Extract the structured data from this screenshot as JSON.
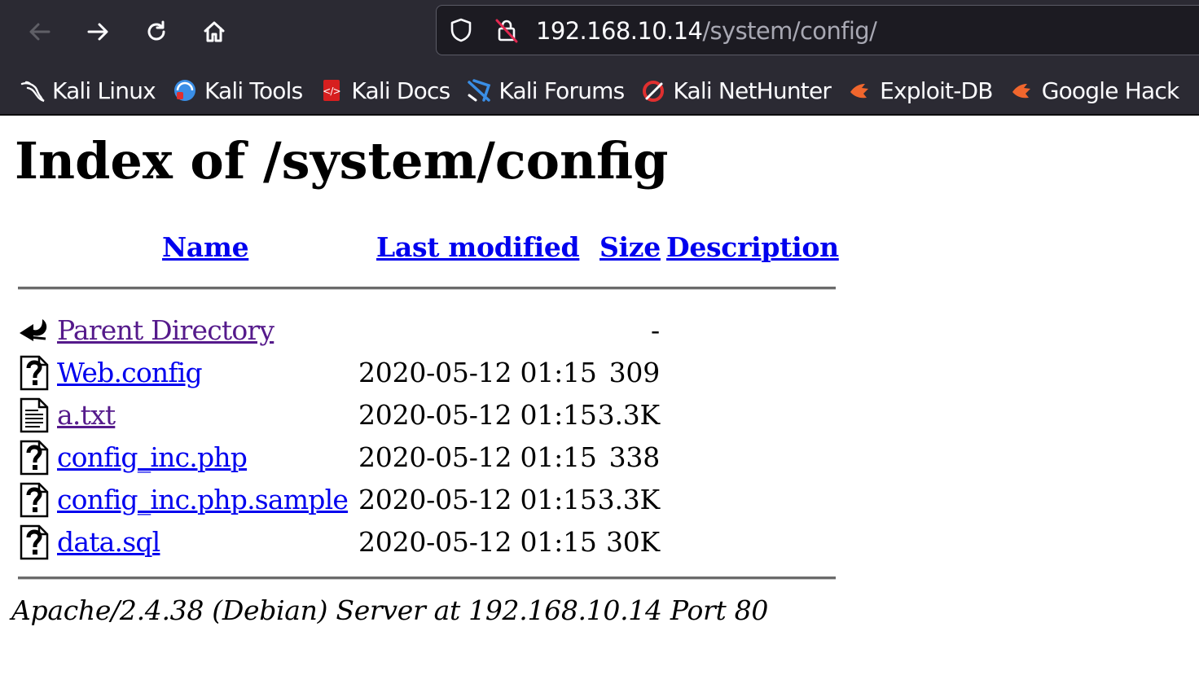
{
  "browser": {
    "url_host": "192.168.10.14",
    "url_path": "/system/config/",
    "bookmarks": [
      {
        "label": "Kali Linux",
        "icon": "kali-dragon-icon"
      },
      {
        "label": "Kali Tools",
        "icon": "kali-tools-icon"
      },
      {
        "label": "Kali Docs",
        "icon": "kali-docs-icon"
      },
      {
        "label": "Kali Forums",
        "icon": "kali-forums-icon"
      },
      {
        "label": "Kali NetHunter",
        "icon": "kali-nethunter-icon"
      },
      {
        "label": "Exploit-DB",
        "icon": "exploit-db-icon"
      },
      {
        "label": "Google Hack",
        "icon": "google-hacking-icon"
      }
    ]
  },
  "page": {
    "title": "Index of /system/config",
    "columns": {
      "name": "Name",
      "last_modified": "Last modified",
      "size": "Size",
      "description": "Description"
    },
    "entries": [
      {
        "name": "Parent Directory",
        "date": "",
        "size": "-",
        "icon": "back-folder-icon",
        "visited": true
      },
      {
        "name": "Web.config",
        "date": "2020-05-12 01:15",
        "size": "309",
        "icon": "unknown-file-icon",
        "visited": false
      },
      {
        "name": "a.txt",
        "date": "2020-05-12 01:15",
        "size": "3.3K",
        "icon": "text-file-icon",
        "visited": true
      },
      {
        "name": "config_inc.php",
        "date": "2020-05-12 01:15",
        "size": "338",
        "icon": "unknown-file-icon",
        "visited": false
      },
      {
        "name": "config_inc.php.sample",
        "date": "2020-05-12 01:15",
        "size": "3.3K",
        "icon": "unknown-file-icon",
        "visited": false
      },
      {
        "name": "data.sql",
        "date": "2020-05-12 01:15",
        "size": "30K",
        "icon": "unknown-file-icon",
        "visited": false
      }
    ],
    "footer": "Apache/2.4.38 (Debian) Server at 192.168.10.14 Port 80"
  },
  "colors": {
    "chrome_bg": "#2b2a33",
    "urlbar_bg": "#1c1b22",
    "link": "#0000ee",
    "visited_link": "#551a8b"
  }
}
